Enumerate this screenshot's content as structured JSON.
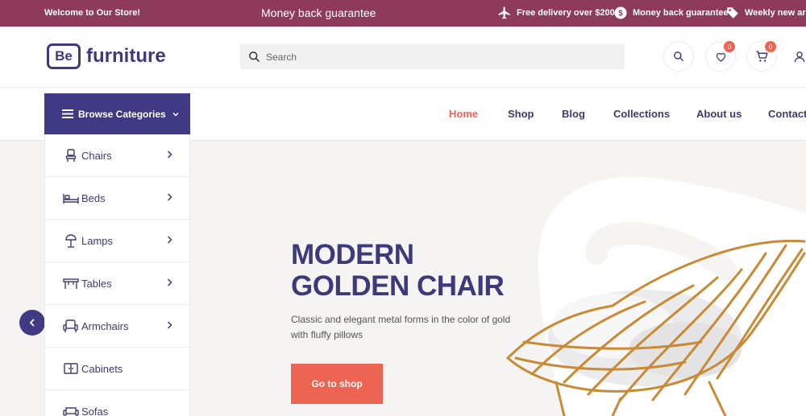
{
  "topbar": {
    "welcome": "Welcome to Our Store!",
    "center": "Money back guarantee",
    "features": [
      {
        "icon": "airplane-icon",
        "label": "Free delivery over $200"
      },
      {
        "icon": "dollar-icon",
        "label": "Money back guarantee"
      },
      {
        "icon": "tag-icon",
        "label": "Weekly new arrivals"
      }
    ]
  },
  "header": {
    "logo_mark": "Be",
    "logo_text": "furniture",
    "search_placeholder": "Search",
    "wishlist_count": "0",
    "cart_count": "0"
  },
  "nav": {
    "browse_label": "Browse Categories",
    "links": [
      "Home",
      "Shop",
      "Blog",
      "Collections",
      "About us",
      "Contact"
    ],
    "active": "Home"
  },
  "categories": [
    {
      "label": "Chairs",
      "icon": "chair-icon",
      "has_sub": true
    },
    {
      "label": "Beds",
      "icon": "bed-icon",
      "has_sub": true
    },
    {
      "label": "Lamps",
      "icon": "lamp-icon",
      "has_sub": true
    },
    {
      "label": "Tables",
      "icon": "table-icon",
      "has_sub": true
    },
    {
      "label": "Armchairs",
      "icon": "armchair-icon",
      "has_sub": true
    },
    {
      "label": "Cabinets",
      "icon": "cabinet-icon",
      "has_sub": false
    },
    {
      "label": "Sofas",
      "icon": "sofa-icon",
      "has_sub": false
    }
  ],
  "hero": {
    "title_line1": "MODERN",
    "title_line2": "GOLDEN CHAIR",
    "description": "Classic and elegant metal forms in the color of gold with fluffy pillows",
    "cta": "Go to shop"
  },
  "colors": {
    "topbar": "#8e3a5a",
    "brand": "#3f3a83",
    "accent": "#ee6452",
    "hero_bg": "#f5f4f3",
    "gold": "#c88a34"
  }
}
